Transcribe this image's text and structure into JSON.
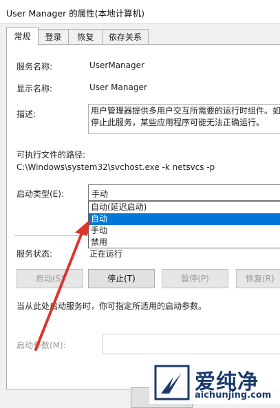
{
  "window": {
    "title": "User Manager 的属性(本地计算机)"
  },
  "tabs": [
    {
      "label": "常规",
      "active": true
    },
    {
      "label": "登录",
      "active": false
    },
    {
      "label": "恢复",
      "active": false
    },
    {
      "label": "依存关系",
      "active": false
    }
  ],
  "general": {
    "service_name_label": "服务名称:",
    "service_name_value": "UserManager",
    "display_name_label": "显示名称:",
    "display_name_value": "User Manager",
    "description_label": "描述:",
    "description_line1": "用户管理器提供多用户交互所需要的运行时组件。如",
    "description_line2": "停止此服务，某些应用程序可能无法正确运行。",
    "exe_path_label": "可执行文件的路径:",
    "exe_path_value": "C:\\Windows\\system32\\svchost.exe -k netsvcs -p",
    "startup_type_label": "启动类型(E):",
    "startup_type_value": "手动",
    "startup_options": [
      {
        "label": "自动(延迟启动)",
        "selected": false
      },
      {
        "label": "自动",
        "selected": true
      },
      {
        "label": "手动",
        "selected": false
      },
      {
        "label": "禁用",
        "selected": false
      }
    ],
    "service_status_label": "服务状态:",
    "service_status_value": "正在运行",
    "buttons": {
      "start": "启动(S)",
      "stop": "停止(T)",
      "pause": "暂停(P)",
      "resume": "恢复(R)"
    },
    "start_params_hint": "当从此处启动服务时，你可指定所适用的启动参数。",
    "start_params_label": "启动参数(M):"
  },
  "watermark": {
    "text": "爱纯净",
    "url": "aichunjing.com"
  },
  "colors": {
    "highlight": "#0078d7",
    "arrow": "#d9362b",
    "watermark": "#1b3a6b"
  }
}
